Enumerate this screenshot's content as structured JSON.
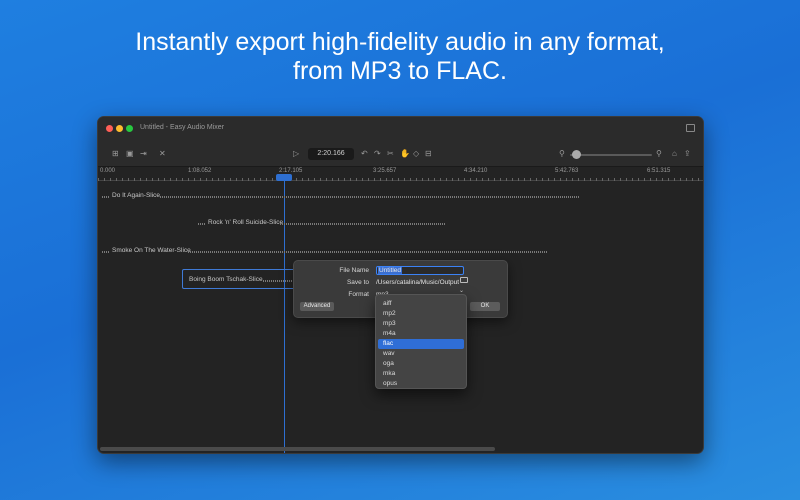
{
  "headline": {
    "line1": "Instantly export high-fidelity audio in any format,",
    "line2": "from MP3 to FLAC."
  },
  "window": {
    "title": "Untitled - Easy Audio Mixer"
  },
  "toolbar": {
    "time": "2:20.166",
    "icons": [
      "add-file-icon",
      "trash-icon",
      "export-icon",
      "close-icon",
      "play-icon",
      "undo-icon",
      "redo-icon",
      "scissors-icon",
      "hand-icon",
      "split-icon",
      "zoom-out-icon",
      "zoom-in-icon",
      "lock-icon",
      "share-icon"
    ]
  },
  "ruler": {
    "ticks": [
      "0.000",
      "1:08.052",
      "2:17.105",
      "3:25.657",
      "4:34.210",
      "5:42.763",
      "6:51.315"
    ]
  },
  "tracks": [
    {
      "label": "Do It Again-Slice"
    },
    {
      "label": "Rock 'n' Roll Suicide-Slice"
    },
    {
      "label": "Smoke On The Water-Slice"
    },
    {
      "label": "Boing Boom Tschak-Slice"
    }
  ],
  "export": {
    "file_name_label": "File Name",
    "file_name_value": "Untitled",
    "save_to_label": "Save to",
    "save_to_value": "/Users/catalina/Music/Output",
    "format_label": "Format",
    "format_value": "mp3",
    "advanced_button": "Advanced",
    "ok_button": "OK"
  },
  "format_dropdown": {
    "options": [
      "aiff",
      "mp2",
      "mp3",
      "m4a",
      "flac",
      "wav",
      "oga",
      "mka",
      "opus"
    ],
    "highlighted": "flac"
  },
  "colors": {
    "background": "#1f7fe0",
    "accent": "#2f6ed6"
  }
}
